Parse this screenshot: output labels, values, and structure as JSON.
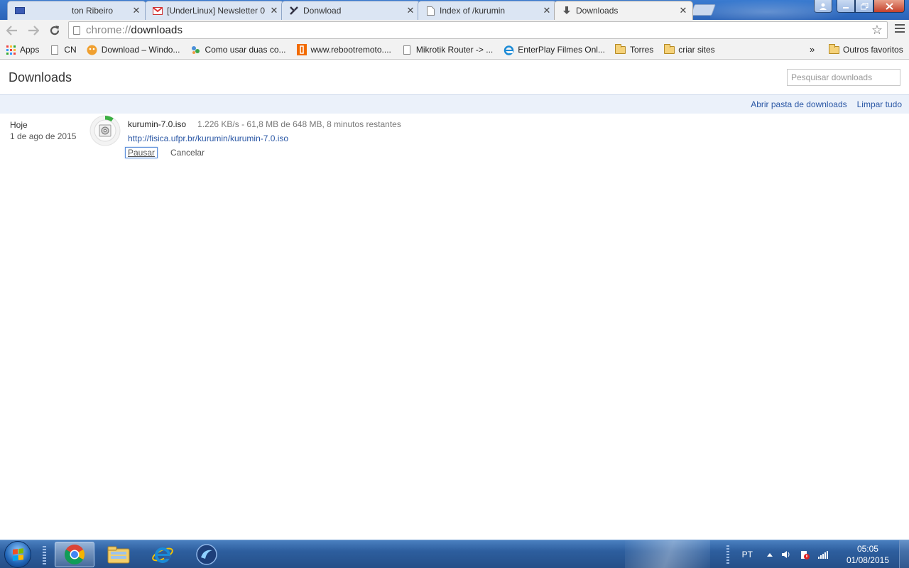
{
  "tabs": [
    {
      "title": "ton Ribeiro",
      "icon": "mail-icon"
    },
    {
      "title": "[UnderLinux] Newsletter 0",
      "icon": "gmail-icon"
    },
    {
      "title": "Donwload",
      "icon": "site-favicon-icon"
    },
    {
      "title": "Index of /kurumin",
      "icon": "page-icon"
    },
    {
      "title": "Downloads",
      "icon": "download-icon",
      "active": true
    }
  ],
  "toolbar": {
    "url_scheme": "chrome://",
    "url_path": "downloads"
  },
  "bookmarks": [
    {
      "label": "Apps",
      "icon": "apps-grid-icon"
    },
    {
      "label": "CN",
      "icon": "page-icon"
    },
    {
      "label": "Download – Windo...",
      "icon": "site-favicon-icon"
    },
    {
      "label": "Como usar duas co...",
      "icon": "site-favicon-icon"
    },
    {
      "label": "www.rebootremoto....",
      "icon": "site-favicon-icon"
    },
    {
      "label": "Mikrotik Router -> ...",
      "icon": "page-icon"
    },
    {
      "label": "EnterPlay Filmes Onl...",
      "icon": "ie-icon"
    },
    {
      "label": "Torres",
      "icon": "folder-icon"
    },
    {
      "label": "criar sites",
      "icon": "folder-icon"
    }
  ],
  "bookmarks_more": "»",
  "bookmarks_other": "Outros favoritos",
  "page": {
    "title": "Downloads",
    "search_placeholder": "Pesquisar downloads",
    "open_folder": "Abrir pasta de downloads",
    "clear_all": "Limpar tudo"
  },
  "download": {
    "day": "Hoje",
    "date": "1 de ago de 2015",
    "file_name": "kurumin-7.0.iso",
    "status": "1.226 KB/s - 61,8 MB de 648 MB, 8 minutos restantes",
    "url": "http://fisica.ufpr.br/kurumin/kurumin-7.0.iso",
    "pause": "Pausar",
    "cancel": "Cancelar",
    "progress_fraction": 0.095
  },
  "taskbar": {
    "language": "PT",
    "time": "05:05",
    "date": "01/08/2015"
  },
  "colors": {
    "accent_link": "#2a57a5",
    "progress_green": "#3cb043",
    "taskbar_blue": "#2d5e9e"
  }
}
